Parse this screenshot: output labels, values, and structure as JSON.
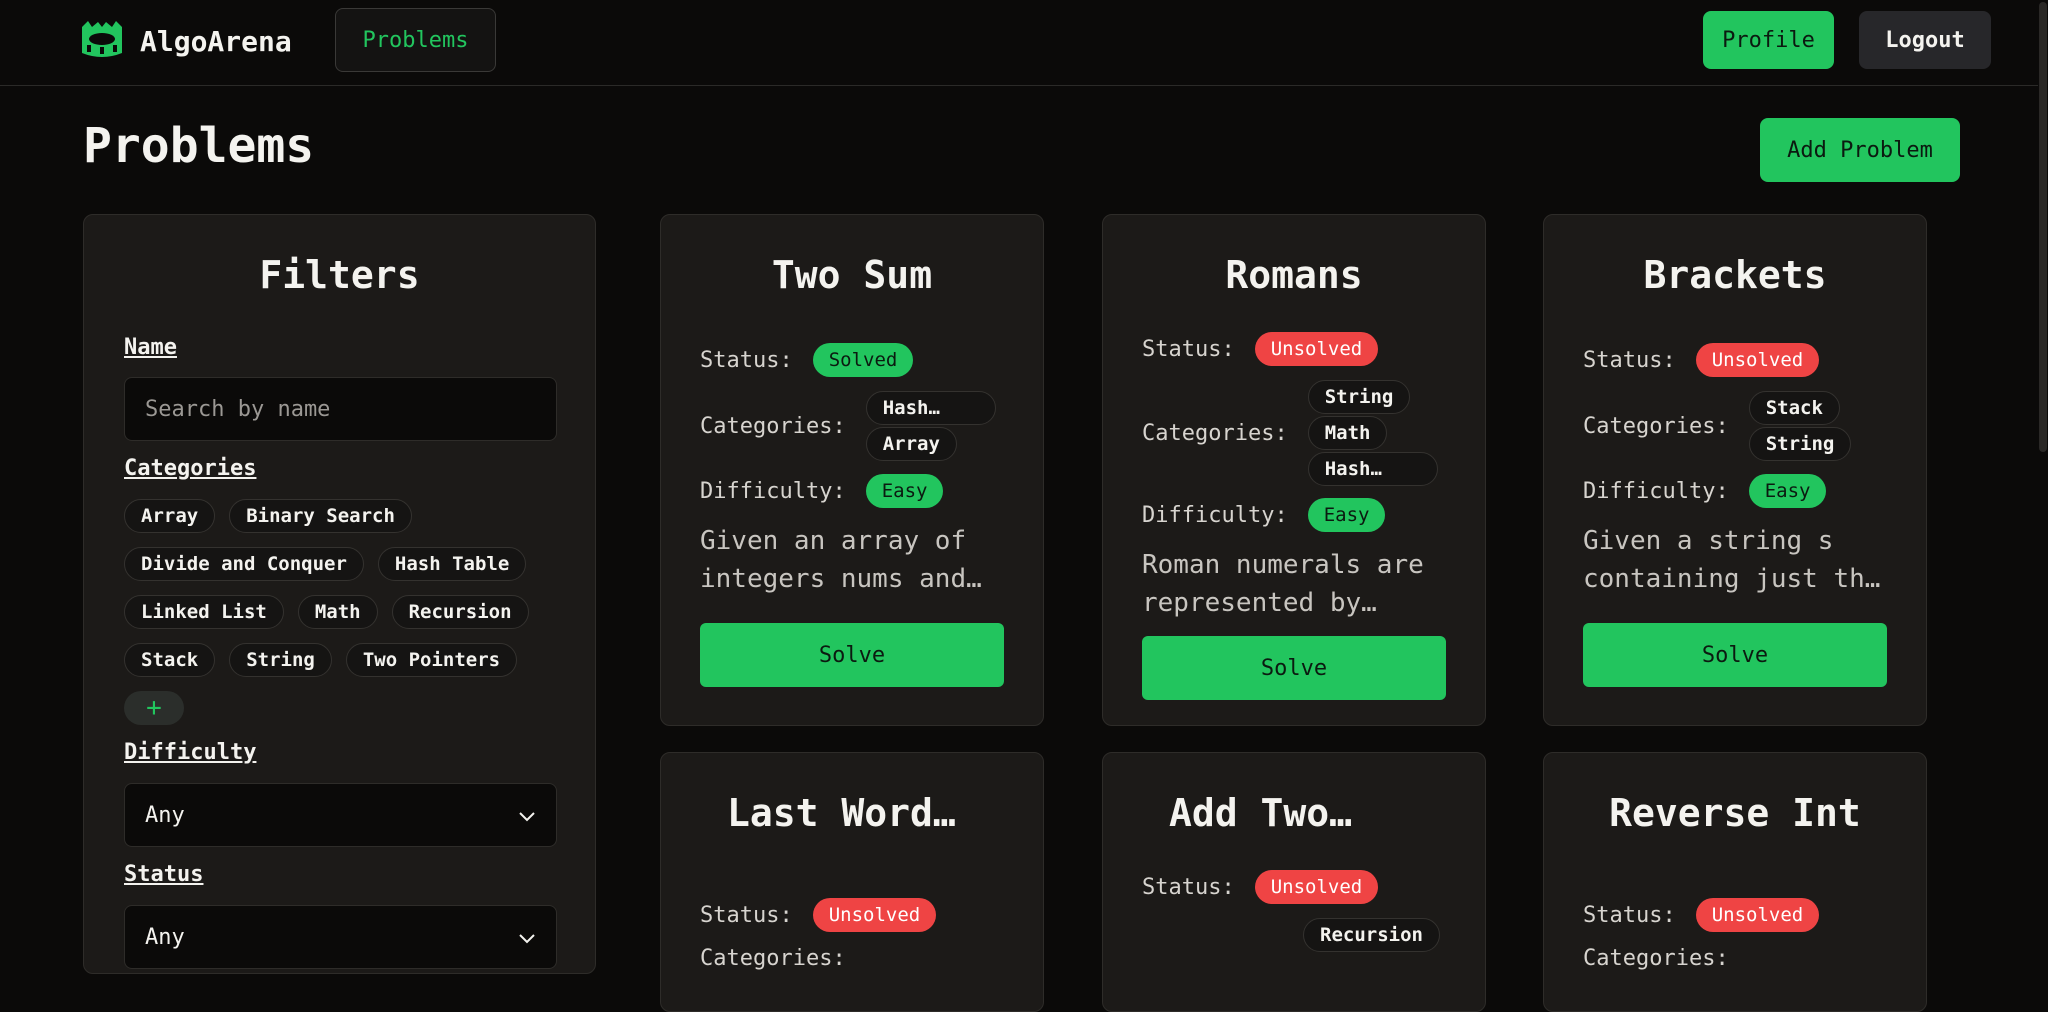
{
  "nav": {
    "brand": "AlgoArena",
    "problems_label": "Problems",
    "profile_label": "Profile",
    "logout_label": "Logout"
  },
  "page": {
    "title": "Problems",
    "add_problem_label": "Add Problem"
  },
  "filters": {
    "title": "Filters",
    "name_label": "Name",
    "name_placeholder": "Search by name",
    "categories_label": "Categories",
    "categories": [
      "Array",
      "Binary Search",
      "Divide and Conquer",
      "Hash Table",
      "Linked List",
      "Math",
      "Recursion",
      "Stack",
      "String",
      "Two Pointers"
    ],
    "add_category": "+",
    "difficulty_label": "Difficulty",
    "difficulty_value": "Any",
    "status_label": "Status",
    "status_value": "Any"
  },
  "labels": {
    "status": "Status:",
    "categories": "Categories:",
    "difficulty": "Difficulty:",
    "solve": "Solve"
  },
  "problems": [
    {
      "title": "Two Sum",
      "status": "Solved",
      "categories": [
        "Hash…",
        "Array"
      ],
      "difficulty": "Easy",
      "description": "Given an array of integers nums and…"
    },
    {
      "title": "Romans",
      "status": "Unsolved",
      "categories": [
        "String",
        "Math",
        "Hash…"
      ],
      "difficulty": "Easy",
      "description": "Roman numerals are represented by…"
    },
    {
      "title": "Brackets",
      "status": "Unsolved",
      "categories": [
        "Stack",
        "String"
      ],
      "difficulty": "Easy",
      "description": "Given a string s containing just th…"
    },
    {
      "title": "Last Word…",
      "status": "Unsolved",
      "categories": []
    },
    {
      "title": "Add Two…",
      "status": "Unsolved",
      "categories": [
        "Recursion"
      ]
    },
    {
      "title": "Reverse Int",
      "status": "Unsolved",
      "categories": []
    }
  ],
  "colors": {
    "accent": "#22c55e",
    "danger": "#ef4444",
    "card_bg": "#1c1a18",
    "page_bg": "#0b0a09"
  }
}
